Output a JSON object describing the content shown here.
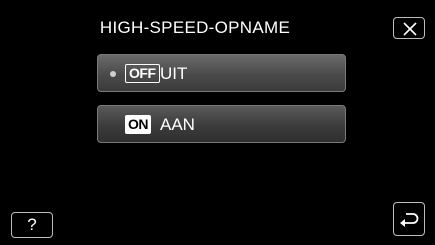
{
  "header": {
    "title": "HIGH-SPEED-OPNAME",
    "close_icon": "close-icon"
  },
  "options": [
    {
      "badge": "OFF",
      "label": "UIT",
      "selected": true
    },
    {
      "badge": "ON",
      "label": "AAN",
      "selected": false
    }
  ],
  "footer": {
    "help_label": "?",
    "back_icon": "return-icon"
  },
  "colors": {
    "background": "#000000",
    "button_gradient_top": "#5a5a5a",
    "button_gradient_bottom": "#2f2f2f",
    "text": "#ffffff"
  }
}
